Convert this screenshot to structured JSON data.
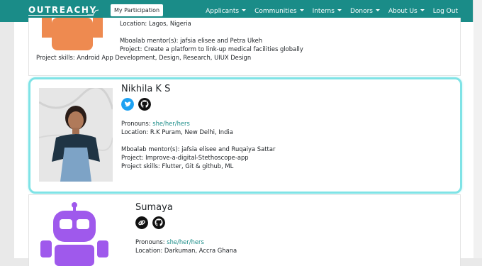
{
  "navbar": {
    "logo_text": "OUTREACHY",
    "participation_button": "My Participation",
    "menu": [
      {
        "label": "Applicants",
        "dropdown": true
      },
      {
        "label": "Communities",
        "dropdown": true
      },
      {
        "label": "Interns",
        "dropdown": true
      },
      {
        "label": "Donors",
        "dropdown": true
      },
      {
        "label": "About Us",
        "dropdown": true
      },
      {
        "label": "Log Out",
        "dropdown": false
      }
    ]
  },
  "colors": {
    "navbar": "#1a8c88",
    "highlight_border": "#7fe3e6",
    "avatar_orange": "#ee8a50",
    "avatar_purple": "#9f59ec",
    "twitter_blue": "#1da1f2"
  },
  "interns": [
    {
      "location": "Location: Lagos, Nigeria",
      "mentors": "Mboalab mentor(s): jafsia elisee and Petra Ukeh",
      "project": "Project: Create a platform to link-up medical facilities globally",
      "skills": "Project skills: Android App Development, Design, Research, UIUX Design",
      "avatar": "orange-robot-avatar"
    },
    {
      "name": "Nikhila K S",
      "social_icons": [
        "twitter-icon",
        "github-icon"
      ],
      "pronouns_label": "Pronouns:",
      "pronouns": "she/her/hers",
      "location": "Location: R.K Puram, New Delhi, India",
      "mentors": "Mboalab mentor(s): jafsia elisee and Ruqaiya Sattar",
      "project": "Project: Improve-a-digital-Stethoscope-app",
      "skills": "Project skills: Flutter, Git & github, ML",
      "avatar": "profile-photo"
    },
    {
      "name": "Sumaya",
      "social_icons": [
        "link-icon",
        "github-icon"
      ],
      "pronouns_label": "Pronouns:",
      "pronouns": "she/her/hers",
      "location": "Location: Darkuman, Accra Ghana",
      "avatar": "purple-robot-avatar"
    }
  ]
}
